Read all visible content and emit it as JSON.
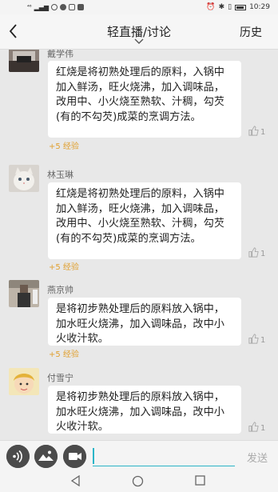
{
  "status_bar": {
    "time": "10:29",
    "signal_text": "46"
  },
  "nav": {
    "title": "轻直播/讨论",
    "history_label": "历史"
  },
  "messages": [
    {
      "user": "戴学伟",
      "text": "红烧是将初熟处理后的原料，入锅中加入鲜汤，旺火烧沸，加入调味品，改用中、小火烧至熟软、汁稠，勾芡(有的不勾芡)成菜的烹调方法。",
      "exp": "+5 经验",
      "likes": "1"
    },
    {
      "user": "林玉琳",
      "text": "红烧是将初熟处理后的原料，入锅中加入鲜汤，旺火烧沸，加入调味品，改用中、小火烧至熟软、汁稠，勾芡(有的不勾芡)成菜的烹调方法。",
      "exp": "+5 经验",
      "likes": "1"
    },
    {
      "user": "燕京帅",
      "text": "是将初步熟处理后的原料放入锅中，加水旺火烧沸，加入调味品，改中小火收汁软。",
      "exp": "+5 经验",
      "likes": "1"
    },
    {
      "user": "付雪宁",
      "text": "是将初步熟处理后的原料放入锅中，加水旺火烧沸，加入调味品，改中小火收汁软。",
      "exp": "",
      "likes": "1"
    }
  ],
  "input": {
    "placeholder": "",
    "send_label": "发送"
  },
  "colors": {
    "accent": "#2bb5c8",
    "exp": "#e0a030",
    "bubble": "#ffffff",
    "background": "#e8e8e8"
  },
  "icons": {
    "back": "chevron-left-icon",
    "dropdown": "chevron-down-icon",
    "voice": "voice-icon",
    "image": "image-icon",
    "video": "video-icon",
    "like": "thumbs-up-icon"
  }
}
